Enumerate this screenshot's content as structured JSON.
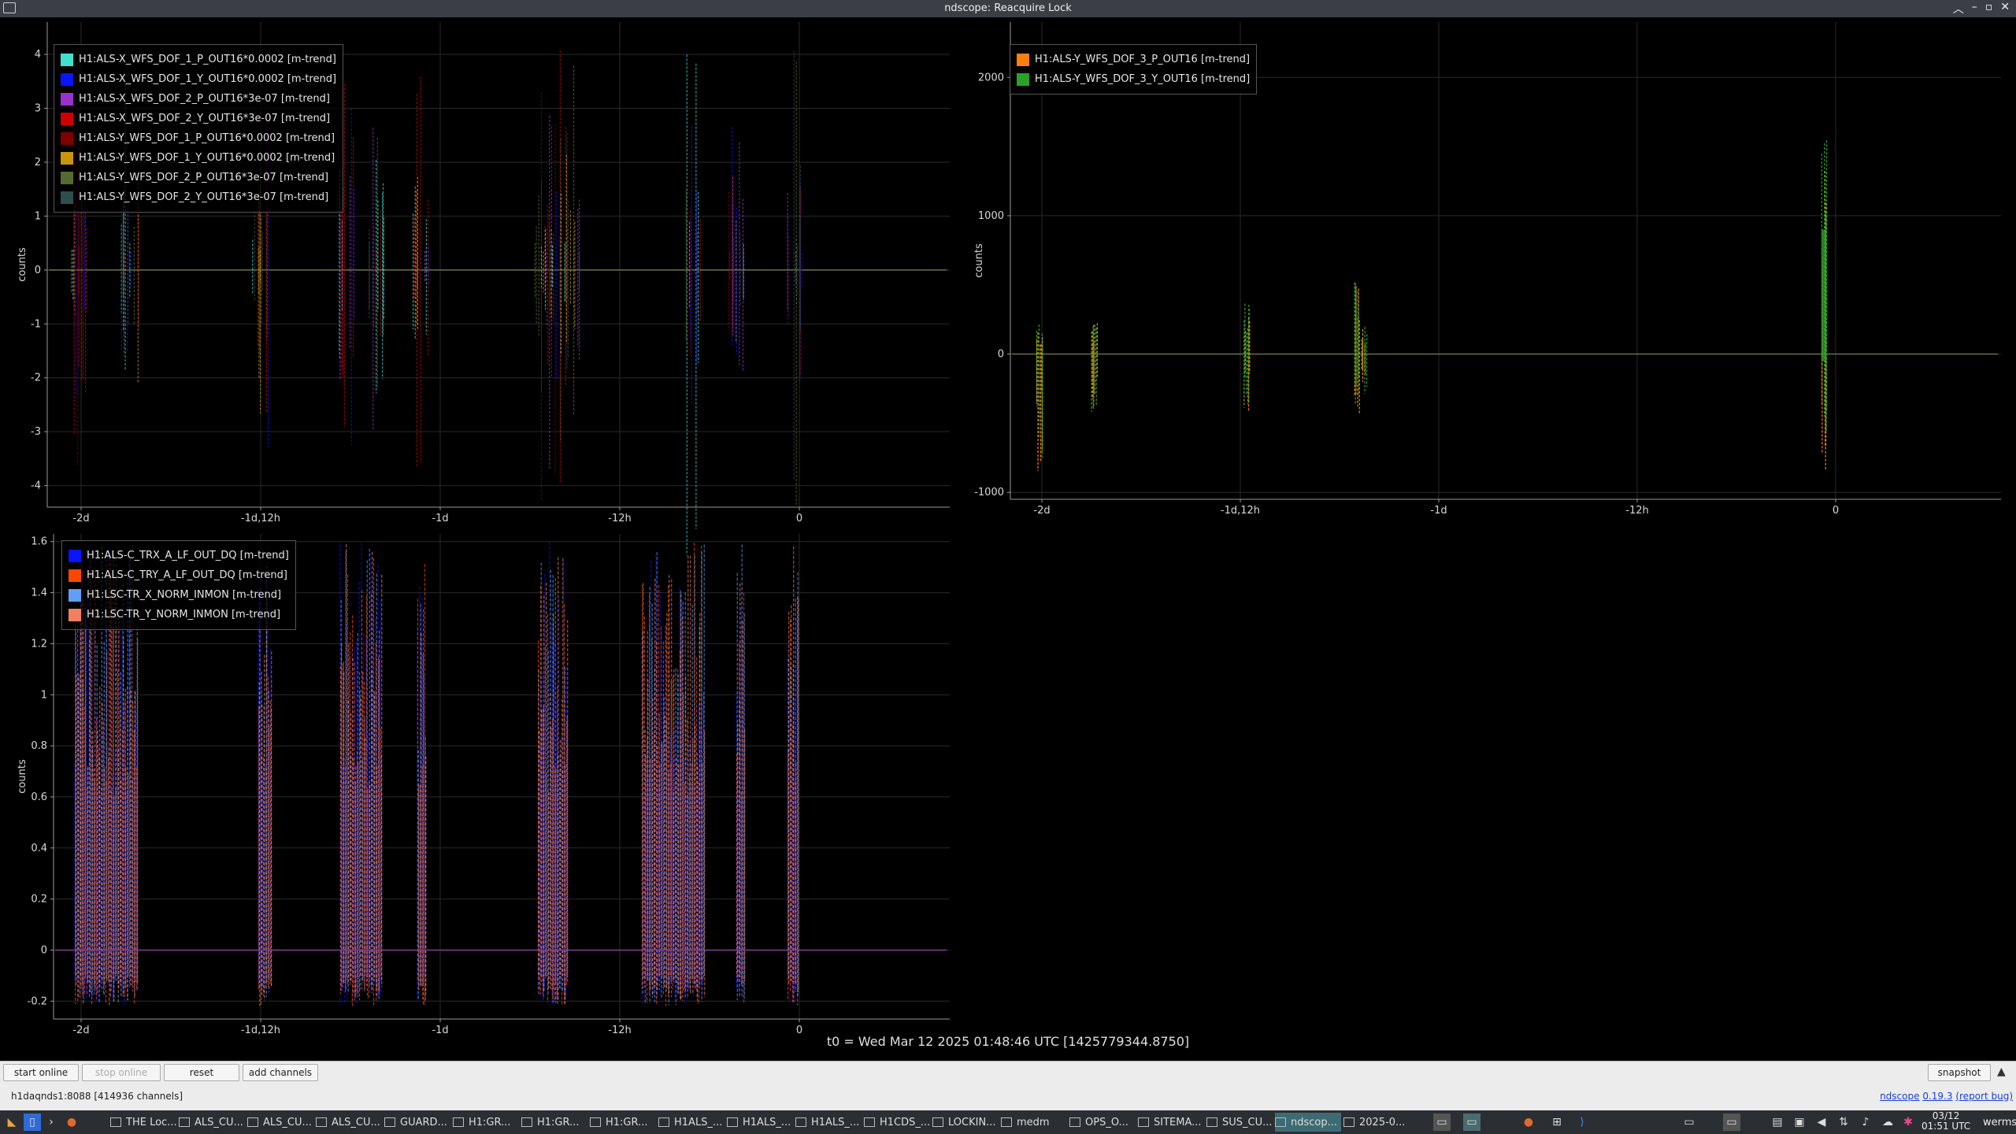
{
  "window": {
    "title": "ndscope: Reacquire Lock"
  },
  "colors": {
    "background": "#000000",
    "grid": "#2a2a2a",
    "axis": "#9a9a9a"
  },
  "plots": [
    {
      "id": "top-left",
      "ylabel": "counts",
      "yticks": [
        4,
        3,
        2,
        1,
        0,
        -1,
        -2,
        -3,
        -4
      ],
      "ylim": [
        -4.4,
        4.6
      ],
      "xticks": [
        "-2d",
        "-1d,12h",
        "-1d",
        "-12h",
        "0"
      ],
      "legend": [
        {
          "label": "H1:ALS-X_WFS_DOF_1_P_OUT16*0.0002 [m-trend]",
          "color": "#40e0d0"
        },
        {
          "label": "H1:ALS-X_WFS_DOF_1_Y_OUT16*0.0002 [m-trend]",
          "color": "#0a14ff"
        },
        {
          "label": "H1:ALS-X_WFS_DOF_2_P_OUT16*3e-07 [m-trend]",
          "color": "#9932cc"
        },
        {
          "label": "H1:ALS-X_WFS_DOF_2_Y_OUT16*3e-07 [m-trend]",
          "color": "#d00000"
        },
        {
          "label": "H1:ALS-Y_WFS_DOF_1_P_OUT16*0.0002 [m-trend]",
          "color": "#800000"
        },
        {
          "label": "H1:ALS-Y_WFS_DOF_1_Y_OUT16*0.0002 [m-trend]",
          "color": "#c8960a"
        },
        {
          "label": "H1:ALS-Y_WFS_DOF_2_P_OUT16*3e-07 [m-trend]",
          "color": "#556b2f"
        },
        {
          "label": "H1:ALS-Y_WFS_DOF_2_Y_OUT16*3e-07 [m-trend]",
          "color": "#2f4f4f"
        }
      ]
    },
    {
      "id": "top-right",
      "ylabel": "counts",
      "yticks": [
        2000,
        1000,
        0,
        -1000
      ],
      "ylim": [
        -1050,
        2400
      ],
      "xticks": [
        "-2d",
        "-1d,12h",
        "-1d",
        "-12h",
        "0"
      ],
      "legend": [
        {
          "label": "H1:ALS-Y_WFS_DOF_3_P_OUT16 [m-trend]",
          "color": "#ff7f0e"
        },
        {
          "label": "H1:ALS-Y_WFS_DOF_3_Y_OUT16 [m-trend]",
          "color": "#2ca02c"
        }
      ]
    },
    {
      "id": "bottom-left",
      "ylabel": "counts",
      "yticks": [
        1.6,
        1.4,
        1.2,
        1,
        0.8,
        0.6,
        0.4,
        0.2,
        0,
        -0.2
      ],
      "ylim": [
        -0.27,
        1.63
      ],
      "xticks": [
        "-2d",
        "-1d,12h",
        "-1d",
        "-12h",
        "0"
      ],
      "legend": [
        {
          "label": "H1:ALS-C_TRX_A_LF_OUT_DQ [m-trend]",
          "color": "#0a14ff"
        },
        {
          "label": "H1:ALS-C_TRY_A_LF_OUT_DQ [m-trend]",
          "color": "#ff4500"
        },
        {
          "label": "H1:LSC-TR_X_NORM_INMON [m-trend]",
          "color": "#5f9ff5"
        },
        {
          "label": "H1:LSC-TR_Y_NORM_INMON [m-trend]",
          "color": "#f08060"
        }
      ]
    }
  ],
  "t0": "t0 = Wed Mar 12 2025 01:48:46 UTC [1425779344.8750]",
  "controls": {
    "start_online": "start online",
    "stop_online": "stop online",
    "reset": "reset",
    "add_channels": "add channels",
    "snapshot": "snapshot",
    "expand": "▲"
  },
  "status": {
    "server": "h1daqnds1:8088 [414936 channels]",
    "app": "ndscope",
    "version": "0.19.3",
    "report": "(report bug)"
  },
  "taskbar": {
    "tasks": [
      {
        "label": "THE Loc...",
        "active": false
      },
      {
        "label": "ALS_CU...",
        "active": false
      },
      {
        "label": "ALS_CU...",
        "active": false
      },
      {
        "label": "ALS_CU...",
        "active": false
      },
      {
        "label": "GUARD...",
        "active": false
      },
      {
        "label": "H1:GR...",
        "active": false
      },
      {
        "label": "H1:GR...",
        "active": false
      },
      {
        "label": "H1:GR...",
        "active": false
      },
      {
        "label": "H1ALS_...",
        "active": false
      },
      {
        "label": "H1ALS_...",
        "active": false
      },
      {
        "label": "H1ALS_...",
        "active": false
      },
      {
        "label": "H1CDS_...",
        "active": false
      },
      {
        "label": "LOCKIN...",
        "active": false
      },
      {
        "label": "medm",
        "active": false
      },
      {
        "label": "OPS_O...",
        "active": false
      },
      {
        "label": "SITEMA...",
        "active": false
      },
      {
        "label": "SUS_CU...",
        "active": false
      },
      {
        "label": "ndscop...",
        "active": true
      },
      {
        "label": "2025-0...",
        "active": false
      }
    ],
    "date": "03/12",
    "time": "01:51 UTC",
    "user": "werms"
  }
}
